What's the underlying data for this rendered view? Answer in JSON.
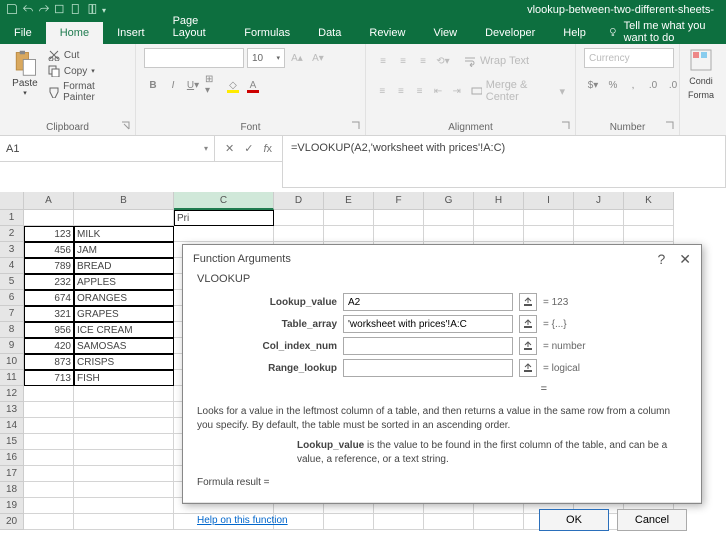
{
  "titlebar": {
    "filename": "vlookup-between-two-different-sheets-"
  },
  "tabs": {
    "file": "File",
    "home": "Home",
    "insert": "Insert",
    "pagelayout": "Page Layout",
    "formulas": "Formulas",
    "data": "Data",
    "review": "Review",
    "view": "View",
    "developer": "Developer",
    "help": "Help",
    "tell": "Tell me what you want to do"
  },
  "ribbon": {
    "paste": "Paste",
    "cut": "Cut",
    "copy": "Copy",
    "format_painter": "Format Painter",
    "clipboard": "Clipboard",
    "font_size": "10",
    "font_group": "Font",
    "wrap": "Wrap Text",
    "merge": "Merge & Center",
    "alignment": "Alignment",
    "numfmt": "Currency",
    "number": "Number",
    "cond": "Condi",
    "format": "Forma"
  },
  "namebox": "A1",
  "formula": "=VLOOKUP(A2,'worksheet with prices'!A:C)",
  "columns": [
    "A",
    "B",
    "C",
    "D",
    "E",
    "F",
    "G",
    "H",
    "I",
    "J",
    "K"
  ],
  "rows": [
    {
      "n": 1,
      "a": "",
      "b": "",
      "c": "Pri"
    },
    {
      "n": 2,
      "a": "123",
      "b": "MILK"
    },
    {
      "n": 3,
      "a": "456",
      "b": "JAM"
    },
    {
      "n": 4,
      "a": "789",
      "b": "BREAD"
    },
    {
      "n": 5,
      "a": "232",
      "b": "APPLES"
    },
    {
      "n": 6,
      "a": "674",
      "b": "ORANGES"
    },
    {
      "n": 7,
      "a": "321",
      "b": "GRAPES"
    },
    {
      "n": 8,
      "a": "956",
      "b": "ICE CREAM"
    },
    {
      "n": 9,
      "a": "420",
      "b": "SAMOSAS"
    },
    {
      "n": 10,
      "a": "873",
      "b": "CRISPS"
    },
    {
      "n": 11,
      "a": "713",
      "b": "FISH"
    }
  ],
  "empty_rows": [
    12,
    13,
    14,
    15,
    16,
    17,
    18,
    19,
    20
  ],
  "dialog": {
    "title": "Function Arguments",
    "fn": "VLOOKUP",
    "args": [
      {
        "label": "Lookup_value",
        "value": "A2",
        "result": "=  123"
      },
      {
        "label": "Table_array",
        "value": "'worksheet with prices'!A:C",
        "result": "=  {...}"
      },
      {
        "label": "Col_index_num",
        "value": "",
        "result": "=  number"
      },
      {
        "label": "Range_lookup",
        "value": "",
        "result": "=  logical"
      }
    ],
    "eq": "=",
    "desc": "Looks for a value in the leftmost column of a table, and then returns a value in the same row from a column you specify. By default, the table must be sorted in an ascending order.",
    "param_name": "Lookup_value",
    "param_desc": "  is the value to be found in the first column of the table, and can be a value, a reference, or a text string.",
    "formula_result_label": "Formula result =",
    "help": "Help on this function",
    "ok": "OK",
    "cancel": "Cancel"
  }
}
